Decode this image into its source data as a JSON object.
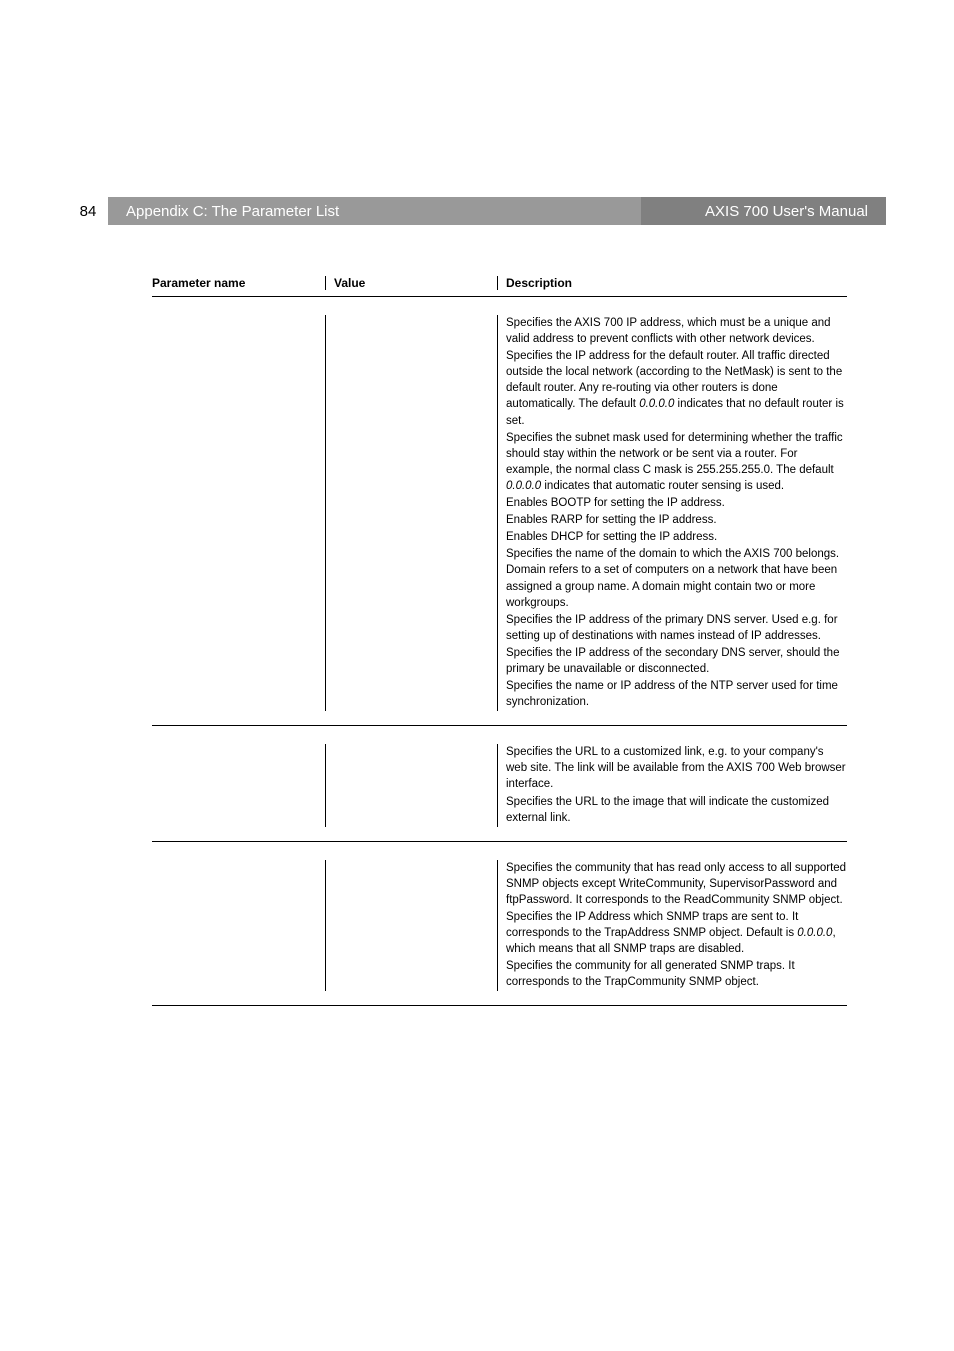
{
  "page_number": "84",
  "header_left": "Appendix C: The Parameter List",
  "header_right": "AXIS 700 User's Manual",
  "table_headers": {
    "param": "Parameter name",
    "value": "Value",
    "desc": "Description"
  },
  "sections": [
    {
      "paragraphs": [
        [
          {
            "text": "Specifies the AXIS 700 IP address, which must be a unique and valid address to prevent conflicts with other network devices."
          }
        ],
        [
          {
            "text": "Specifies the IP address for the default router. All traffic directed outside the local network (according to the NetMask) is sent to the default router. Any re-routing via other routers is done automatically. The default "
          },
          {
            "text": "0.0.0.0",
            "italic": true
          },
          {
            "text": " indicates that no default router is set."
          }
        ],
        [
          {
            "text": "Specifies the subnet mask used for determining whether the traffic should stay within the network or be sent via a router. For example, the normal class C mask is 255.255.255.0. The default "
          },
          {
            "text": "0.0.0.0",
            "italic": true
          },
          {
            "text": " indicates that automatic router sensing is used."
          }
        ],
        [
          {
            "text": "Enables BOOTP for setting the IP address."
          }
        ],
        [
          {
            "text": "Enables RARP for setting the IP address."
          }
        ],
        [
          {
            "text": "Enables DHCP for setting the IP address."
          }
        ],
        [
          {
            "text": "Specifies the name of the domain to which the AXIS 700 belongs. Domain refers to a set of computers on a network that have been assigned a group name. A domain might contain two or more workgroups."
          }
        ],
        [
          {
            "text": "Specifies the IP address of the primary DNS server. Used e.g. for setting up of destinations with names instead of IP addresses."
          }
        ],
        [
          {
            "text": "Specifies the IP address of the secondary DNS server, should the primary be unavailable or disconnected."
          }
        ],
        [
          {
            "text": "Specifies the name or IP address of the NTP server used for time synchronization."
          }
        ]
      ]
    },
    {
      "paragraphs": [
        [
          {
            "text": "Specifies the URL to a customized link, e.g. to your company's web site. The link will be available from the AXIS 700 Web browser interface."
          }
        ],
        [
          {
            "text": "Specifies the URL to the image that will indicate the customized external link."
          }
        ]
      ]
    },
    {
      "paragraphs": [
        [
          {
            "text": "Specifies the community that has read only access to all supported SNMP objects except WriteCommunity, SupervisorPassword and ftpPassword. It corresponds to the ReadCommunity SNMP object."
          }
        ],
        [
          {
            "text": "Specifies the IP Address which SNMP traps are sent to. It corresponds to the TrapAddress SNMP object. Default is "
          },
          {
            "text": "0.0.0.0",
            "italic": true
          },
          {
            "text": ", which means that all SNMP traps are disabled."
          }
        ],
        [
          {
            "text": "Specifies the community for all generated SNMP traps. It corresponds to the TrapCommunity SNMP object."
          }
        ]
      ]
    }
  ]
}
